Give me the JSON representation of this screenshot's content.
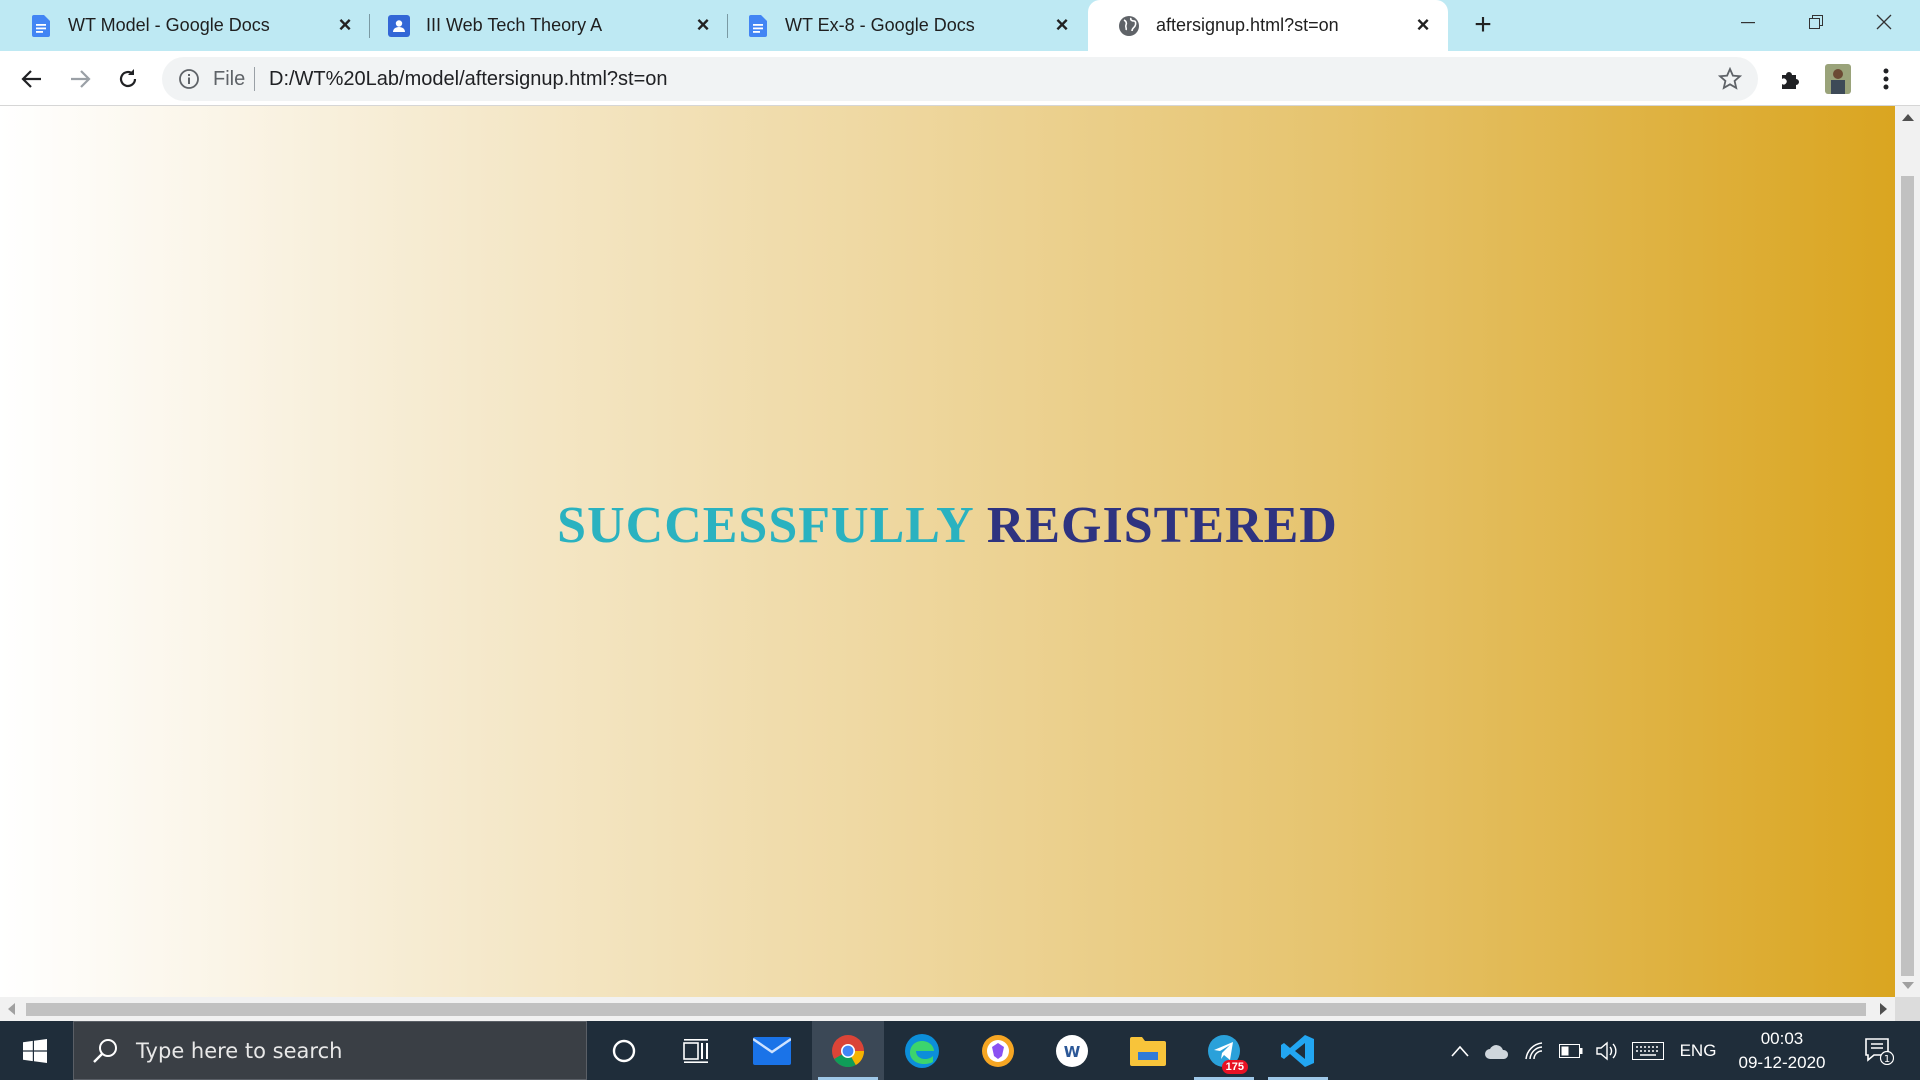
{
  "browser": {
    "tabs": [
      {
        "title": "WT Model - Google Docs",
        "icon": "google-docs-icon"
      },
      {
        "title": "III Web Tech Theory A",
        "icon": "google-classroom-icon"
      },
      {
        "title": "WT Ex-8 - Google Docs",
        "icon": "google-docs-icon"
      },
      {
        "title": "aftersignup.html?st=on",
        "icon": "globe-icon",
        "active": true
      }
    ],
    "omnibox": {
      "scheme_label": "File",
      "url": "D:/WT%20Lab/model/aftersignup.html?st=on"
    }
  },
  "page": {
    "headline_part1": "SUCCESSFULLY",
    "headline_part2": "REGISTERED",
    "colors": {
      "gradient_start": "#ffffff",
      "gradient_end": "#daa520",
      "headline_part1": "#2ab2c0",
      "headline_part2": "#2e3380"
    }
  },
  "taskbar": {
    "search_placeholder": "Type here to search",
    "apps": [
      "cortana-icon",
      "task-view-icon",
      "mail-icon",
      "chrome-icon",
      "edge-icon",
      "brave-icon",
      "wps-icon",
      "file-explorer-icon",
      "telegram-icon",
      "vscode-icon"
    ],
    "telegram_badge": "175",
    "language": "ENG",
    "time": "00:03",
    "date": "09-12-2020",
    "notification_count": "1"
  }
}
